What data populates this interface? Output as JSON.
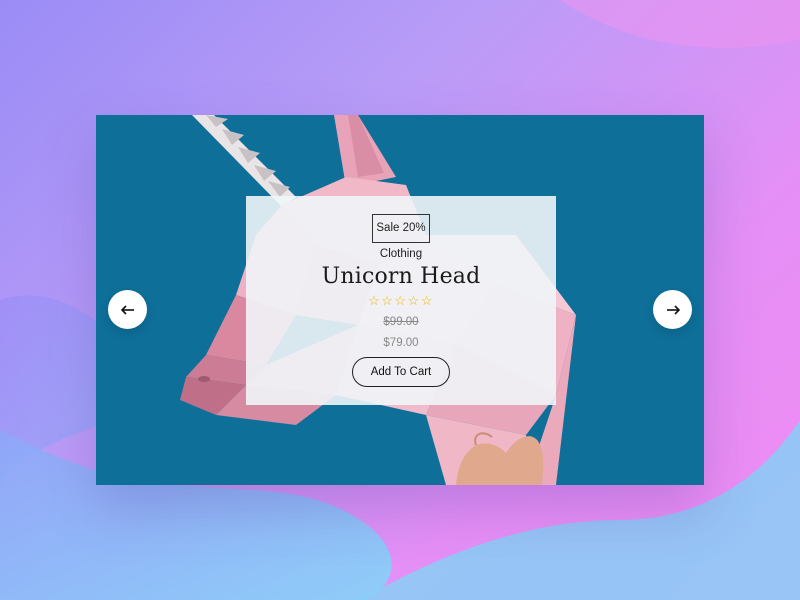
{
  "product": {
    "badge": "Sale 20%",
    "category": "Clothing",
    "title": "Unicorn Head",
    "rating_stars": "☆☆☆☆☆",
    "rating": 0,
    "rating_max": 5,
    "old_price": "$99.00",
    "price": "$79.00",
    "cart_label": "Add To Cart"
  },
  "navigation": {
    "prev_icon": "arrow-left-icon",
    "next_icon": "arrow-right-icon"
  },
  "colors": {
    "photo_background": "#0e6f99",
    "star": "#f2b600",
    "price_muted": "#888888"
  }
}
